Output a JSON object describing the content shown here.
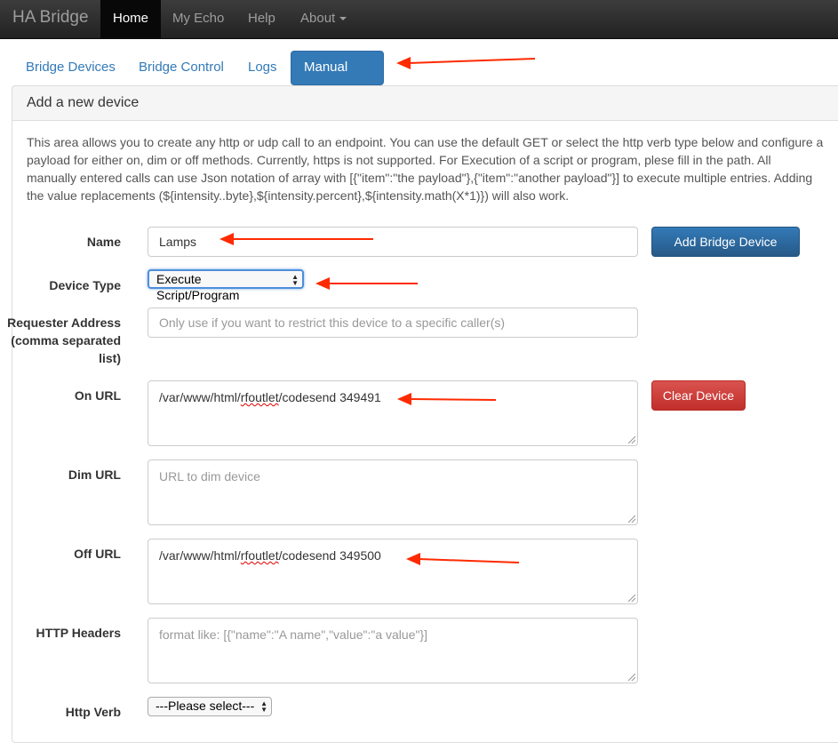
{
  "navbar": {
    "brand": "HA Bridge",
    "items": [
      "Home",
      "My Echo",
      "Help",
      "About"
    ]
  },
  "tabs": [
    "Bridge Devices",
    "Bridge Control",
    "Logs",
    "Manual Add"
  ],
  "panel": {
    "title": "Add a new device",
    "intro_lines": [
      "This area allows you to create any http or udp call to an endpoint. You can use the default GET or select the http verb type below and configure a",
      "payload for either on, dim or off methods. Currently, https is not supported. For Execution of a script or program, plese fill in the path. All",
      "manually entered calls can use Json notation of array with [{\"item\":\"the payload\"},{\"item\":\"another payload\"}] to execute multiple entries. Adding",
      "the value replacements (${intensity..byte},${intensity.percent},${intensity.math(X*1)}) will also work."
    ]
  },
  "form": {
    "name_label": "Name",
    "name_value": "Lamps",
    "add_button": "Add Bridge Device",
    "device_type_label": "Device Type",
    "device_type_value": "Execute Script/Program",
    "requester_label_lines": [
      "Requester Address",
      "(comma separated",
      "list)"
    ],
    "requester_placeholder": "Only use if you want to restrict this device to a specific caller(s)",
    "on_url_label": "On URL",
    "on_url_prefix": "/var/www/html/",
    "on_url_word": "rfoutlet",
    "on_url_suffix": "/codesend 349491",
    "clear_button": "Clear Device",
    "dim_url_label": "Dim URL",
    "dim_url_placeholder": "URL to dim device",
    "off_url_label": "Off URL",
    "off_url_prefix": "/var/www/html/",
    "off_url_word": "rfoutlet",
    "off_url_suffix": "/codesend 349500",
    "http_headers_label": "HTTP Headers",
    "http_headers_placeholder": "format like: [{\"name\":\"A name\",\"value\":\"a value\"}]",
    "http_verb_label": "Http Verb",
    "http_verb_value": "---Please select---"
  },
  "colors": {
    "accent": "#337ab7",
    "danger": "#d9534f",
    "annotation_arrow": "#ff2a00"
  }
}
